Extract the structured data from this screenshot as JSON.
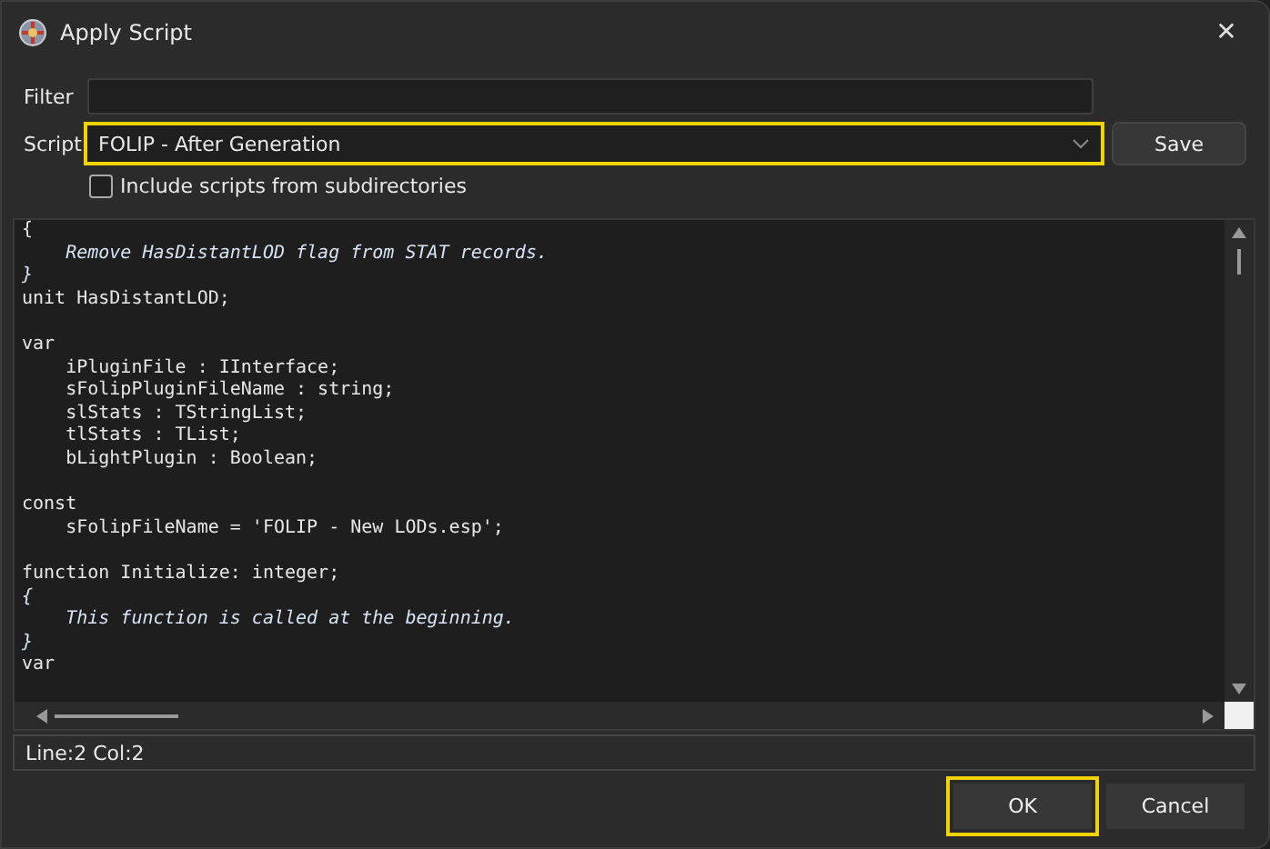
{
  "window": {
    "title": "Apply Script",
    "close": "✕"
  },
  "filter": {
    "label": "Filter"
  },
  "script": {
    "label": "Script",
    "value": "FOLIP - After Generation",
    "highlighted": true
  },
  "save_button": {
    "label": "Save"
  },
  "include_subdirs": {
    "label": "Include scripts from subdirectories",
    "checked": false
  },
  "editor": {
    "lines": [
      {
        "kind": "code",
        "text": "{"
      },
      {
        "kind": "comment",
        "text": "    Remove HasDistantLOD flag from STAT records."
      },
      {
        "kind": "comment",
        "text": "}"
      },
      {
        "kind": "code",
        "text": "unit HasDistantLOD;"
      },
      {
        "kind": "blank"
      },
      {
        "kind": "code",
        "text": "var"
      },
      {
        "kind": "code",
        "text": "    iPluginFile : IInterface;"
      },
      {
        "kind": "code",
        "text": "    sFolipPluginFileName : string;"
      },
      {
        "kind": "code",
        "text": "    slStats : TStringList;"
      },
      {
        "kind": "code",
        "text": "    tlStats : TList;"
      },
      {
        "kind": "code",
        "text": "    bLightPlugin : Boolean;"
      },
      {
        "kind": "blank"
      },
      {
        "kind": "code",
        "text": "const"
      },
      {
        "kind": "code",
        "text": "    sFolipFileName = 'FOLIP - New LODs.esp';"
      },
      {
        "kind": "blank"
      },
      {
        "kind": "code",
        "text": "function Initialize: integer;"
      },
      {
        "kind": "comment",
        "text": "{"
      },
      {
        "kind": "comment",
        "text": "    This function is called at the beginning."
      },
      {
        "kind": "comment",
        "text": "}"
      },
      {
        "kind": "code",
        "text": "var"
      }
    ]
  },
  "status_bar": {
    "text": "Line:2 Col:2"
  },
  "buttons": [
    {
      "label": "OK",
      "highlighted": true
    },
    {
      "label": "Cancel",
      "highlighted": false
    }
  ]
}
